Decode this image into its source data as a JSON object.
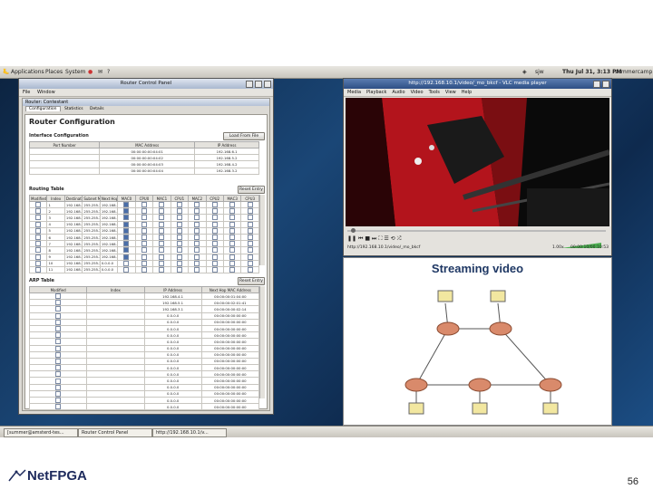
{
  "gnome": {
    "menus": [
      "Applications",
      "Places",
      "System"
    ],
    "user": "sjw",
    "clock": "Thu Jul 31,  3:13 PM",
    "user2": "summercamp"
  },
  "taskbar": {
    "items": [
      "[summer@amsterd-tes...",
      "Router Control Panel",
      "http://192.168.10.1/v..."
    ]
  },
  "router_panel": {
    "title": "Router Control Panel",
    "menu": [
      "File",
      "Window"
    ],
    "inner_title": "Router: Contestant",
    "tabs": [
      "Configuration",
      "Statistics",
      "Details"
    ],
    "heading": "Router Configuration",
    "interface": {
      "label": "Interface Configuration",
      "load_button": "Load From File",
      "columns": [
        "Port Number",
        "MAC Address",
        "IP Address"
      ],
      "rows": [
        [
          "",
          "00:00:00:00:04:01",
          "192.168.6.1"
        ],
        [
          "",
          "00:00:00:00:04:02",
          "192.168.5.2"
        ],
        [
          "",
          "00:00:00:00:04:03",
          "192.168.4.2"
        ],
        [
          "",
          "00:00:00:00:04:04",
          "192.168.3.2"
        ]
      ]
    },
    "routing": {
      "label": "Routing Table",
      "reset_button": "Reset Entry",
      "columns": [
        "Modified",
        "Index",
        "Destination IP",
        "Subnet Mask",
        "Next Hop IP",
        "MAC0",
        "CPU0",
        "MAC1",
        "CPU1",
        "MAC2",
        "CPU2",
        "MAC3",
        "CPU3"
      ],
      "rows": [
        [
          "",
          "1",
          "192.168.10.0",
          "255.255.2...",
          "192.168.5.1"
        ],
        [
          "",
          "2",
          "192.168.14.0",
          "255.255.2...",
          "192.168.4.1"
        ],
        [
          "",
          "3",
          "192.168.17.0",
          "255.255.2...",
          "192.168.3.1"
        ],
        [
          "",
          "4",
          "192.168.11.0",
          "255.255.2...",
          "192.168.4.1"
        ],
        [
          "",
          "5",
          "192.168.12.0",
          "255.255.2...",
          "192.168.4.1"
        ],
        [
          "",
          "6",
          "192.168.13.0",
          "255.255.2...",
          "192.168.5.1"
        ],
        [
          "",
          "7",
          "192.168.8.0",
          "255.255.2...",
          "192.168.3.1"
        ],
        [
          "",
          "8",
          "192.168.9.0",
          "255.255.2...",
          "192.168.5.1"
        ],
        [
          "",
          "9",
          "192.168.7.0",
          "255.255.2...",
          "192.168.4.1"
        ],
        [
          "",
          "10",
          "192.168.15.0",
          "255.255.2...",
          "0.0.0.0"
        ],
        [
          "",
          "11",
          "192.168.16.0",
          "255.255.2...",
          "0.0.0.0"
        ]
      ]
    },
    "arp": {
      "label": "ARP Table",
      "reset_button": "Reset Entry",
      "columns": [
        "Modified",
        "Index",
        "IP Address",
        "Next Hop MAC Address"
      ],
      "rows": [
        [
          "",
          "",
          "192.168.4.1",
          "00:00:00:01:04:00"
        ],
        [
          "",
          "",
          "192.168.5.1",
          "00:00:00:02:01:41"
        ],
        [
          "",
          "",
          "192.168.3.1",
          "00:00:00:00:02:14"
        ],
        [
          "",
          "",
          "0.0.0.0",
          "00:00:00:00:00:00"
        ],
        [
          "",
          "",
          "0.0.0.0",
          "00:00:00:00:00:00"
        ],
        [
          "",
          "",
          "0.0.0.0",
          "00:00:00:00:00:00"
        ],
        [
          "",
          "",
          "0.0.0.0",
          "00:00:00:00:00:00"
        ],
        [
          "",
          "",
          "0.0.0.0",
          "00:00:00:00:00:00"
        ],
        [
          "",
          "",
          "0.0.0.0",
          "00:00:00:00:00:00"
        ],
        [
          "",
          "",
          "0.0.0.0",
          "00:00:00:00:00:00"
        ],
        [
          "",
          "",
          "0.0.0.0",
          "00:00:00:00:00:00"
        ],
        [
          "",
          "",
          "0.0.0.0",
          "00:00:00:00:00:00"
        ],
        [
          "",
          "",
          "0.0.0.0",
          "00:00:00:00:00:00"
        ],
        [
          "",
          "",
          "0.0.0.0",
          "00:00:00:00:00:00"
        ],
        [
          "",
          "",
          "0.0.0.0",
          "00:00:00:00:00:00"
        ],
        [
          "",
          "",
          "0.0.0.0",
          "00:00:00:00:00:00"
        ],
        [
          "",
          "",
          "0.0.0.0",
          "00:00:00:00:00:00"
        ],
        [
          "",
          "",
          "0.0.0.0",
          "00:00:00:00:00:00"
        ]
      ]
    }
  },
  "player": {
    "title": "http://192.168.10.1/video/_mo_bkcf - VLC media player",
    "menu": [
      "Media",
      "Playback",
      "Audio",
      "Video",
      "Tools",
      "View",
      "Help"
    ],
    "status_url": "http://192.168.10.1/video/_mo_bkcf",
    "speed": "1.00x",
    "time": "00:00:10/00:10:53"
  },
  "slide_inner": {
    "title": "Streaming video"
  },
  "footer": {
    "logo_text": "NetFPGA",
    "page_number": "56"
  }
}
